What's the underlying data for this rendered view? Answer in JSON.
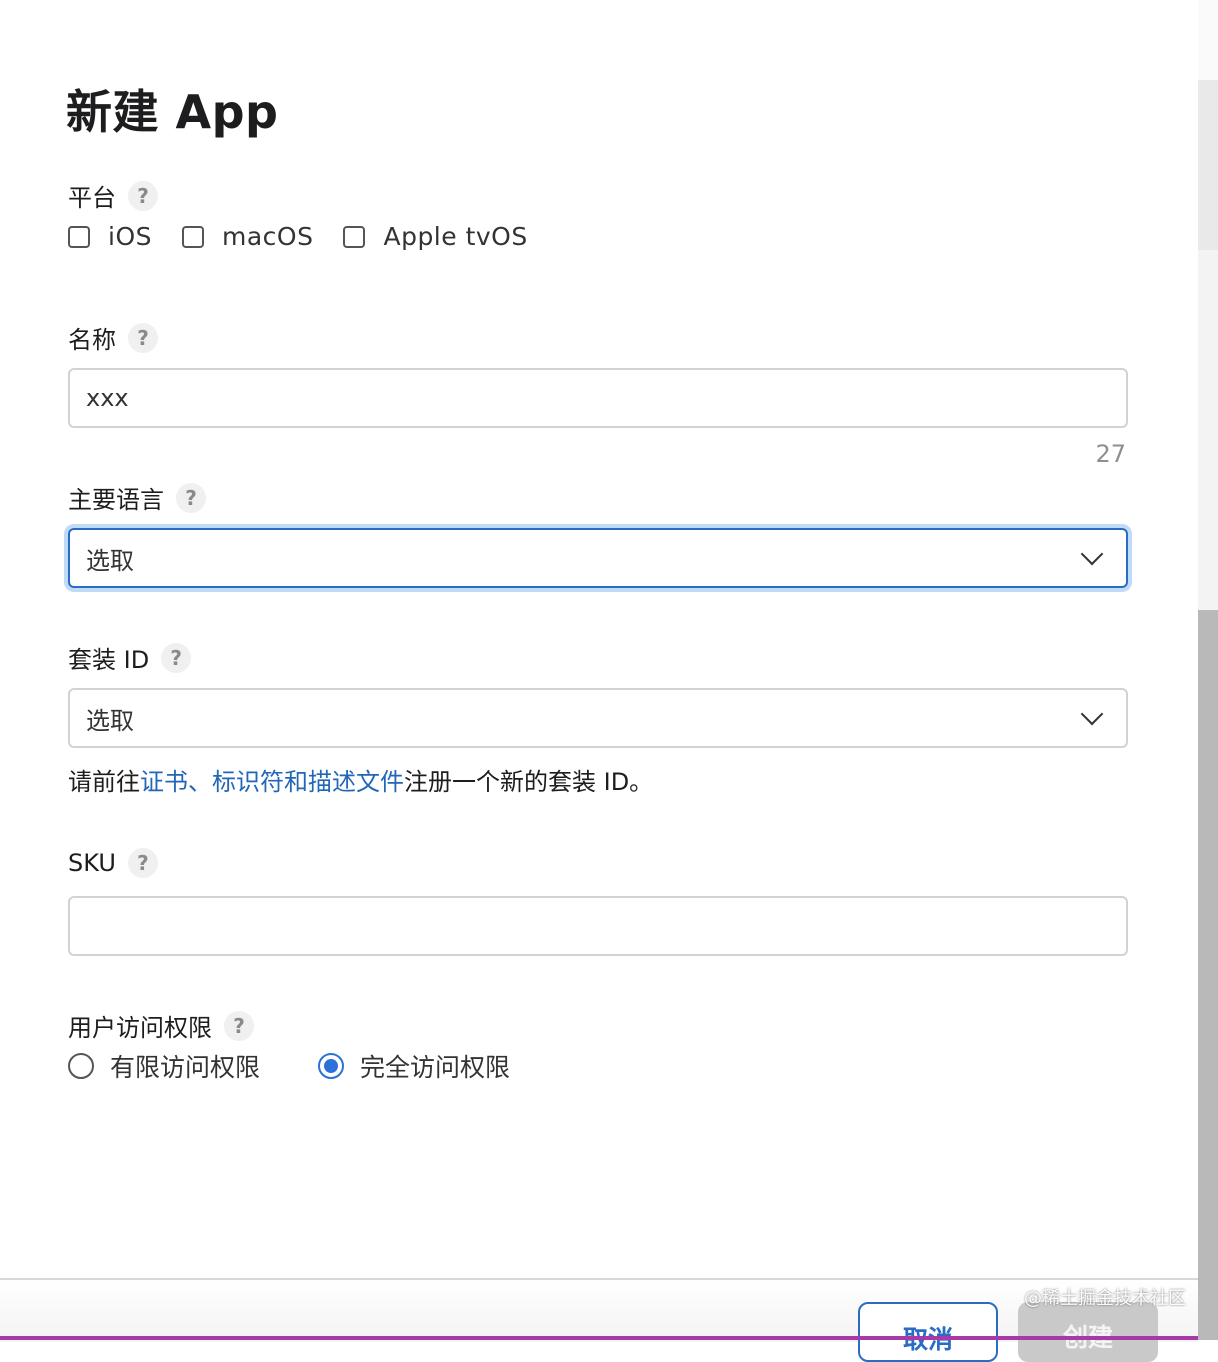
{
  "dialog": {
    "title": "新建 App",
    "help_glyph": "?",
    "platform": {
      "label": "平台",
      "options": [
        {
          "label": "iOS",
          "checked": false
        },
        {
          "label": "macOS",
          "checked": false
        },
        {
          "label": "Apple tvOS",
          "checked": false
        }
      ]
    },
    "name": {
      "label": "名称",
      "value": "xxx",
      "remaining": "27"
    },
    "primary_language": {
      "label": "主要语言",
      "value": "选取"
    },
    "bundle_id": {
      "label": "套装 ID",
      "value": "选取",
      "hint_prefix": "请前往",
      "hint_link": "证书、标识符和描述文件",
      "hint_suffix": "注册一个新的套装 ID。"
    },
    "sku": {
      "label": "SKU",
      "value": ""
    },
    "user_access": {
      "label": "用户访问权限",
      "options": [
        {
          "label": "有限访问权限",
          "selected": false
        },
        {
          "label": "完全访问权限",
          "selected": true
        }
      ]
    },
    "footer": {
      "cancel_label": "取消",
      "create_label": "创建"
    }
  },
  "watermark": "@稀土掘金技术社区",
  "colors": {
    "accent": "#2a6bc4",
    "link": "#2266b8",
    "disabled_button": "#c9c9c9"
  }
}
